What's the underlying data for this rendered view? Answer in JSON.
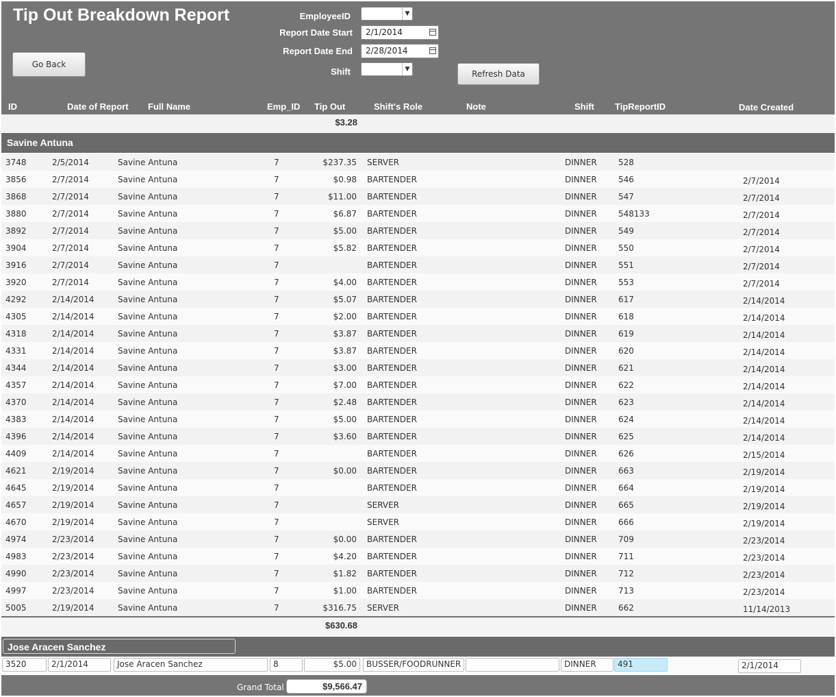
{
  "header": {
    "title": "Tip Out Breakdown Report",
    "go_back_label": "Go Back",
    "refresh_label": "Refresh Data"
  },
  "filters": {
    "employee_id": {
      "label": "EmployeeID",
      "value": ""
    },
    "report_date_start": {
      "label": "Report Date Start",
      "value": "2/1/2014"
    },
    "report_date_end": {
      "label": "Report Date End",
      "value": "2/28/2014"
    },
    "shift": {
      "label": "Shift",
      "value": ""
    }
  },
  "columns": {
    "id": "ID",
    "date_of_report": "Date of Report",
    "full_name": "Full Name",
    "emp_id": "Emp_ID",
    "tip_out": "Tip Out",
    "shifts_role": "Shift's Role",
    "note": "Note",
    "shift": "Shift",
    "tip_report_id": "TipReportID",
    "date_created": "Date Created"
  },
  "report_header_total": "$3.28",
  "groups": [
    {
      "name": "Savine Antuna",
      "total": "$630.68",
      "rows": [
        {
          "id": "3748",
          "date": "2/5/2014",
          "name": "Savine Antuna",
          "emp_id": "7",
          "tip_out": "$237.35",
          "role": "SERVER",
          "note": "",
          "shift": "DINNER",
          "tip_report_id": "528",
          "created": ""
        },
        {
          "id": "3856",
          "date": "2/7/2014",
          "name": "Savine Antuna",
          "emp_id": "7",
          "tip_out": "$0.98",
          "role": "BARTENDER",
          "note": "",
          "shift": "DINNER",
          "tip_report_id": "546",
          "created": "2/7/2014"
        },
        {
          "id": "3868",
          "date": "2/7/2014",
          "name": "Savine Antuna",
          "emp_id": "7",
          "tip_out": "$11.00",
          "role": "BARTENDER",
          "note": "",
          "shift": "DINNER",
          "tip_report_id": "547",
          "created": "2/7/2014"
        },
        {
          "id": "3880",
          "date": "2/7/2014",
          "name": "Savine Antuna",
          "emp_id": "7",
          "tip_out": "$6.87",
          "role": "BARTENDER",
          "note": "",
          "shift": "DINNER",
          "tip_report_id": "548133",
          "created": "2/7/2014"
        },
        {
          "id": "3892",
          "date": "2/7/2014",
          "name": "Savine Antuna",
          "emp_id": "7",
          "tip_out": "$5.00",
          "role": "BARTENDER",
          "note": "",
          "shift": "DINNER",
          "tip_report_id": "549",
          "created": "2/7/2014"
        },
        {
          "id": "3904",
          "date": "2/7/2014",
          "name": "Savine Antuna",
          "emp_id": "7",
          "tip_out": "$5.82",
          "role": "BARTENDER",
          "note": "",
          "shift": "DINNER",
          "tip_report_id": "550",
          "created": "2/7/2014"
        },
        {
          "id": "3916",
          "date": "2/7/2014",
          "name": "Savine Antuna",
          "emp_id": "7",
          "tip_out": "",
          "role": "BARTENDER",
          "note": "",
          "shift": "DINNER",
          "tip_report_id": "551",
          "created": "2/7/2014"
        },
        {
          "id": "3920",
          "date": "2/7/2014",
          "name": "Savine Antuna",
          "emp_id": "7",
          "tip_out": "$4.00",
          "role": "BARTENDER",
          "note": "",
          "shift": "DINNER",
          "tip_report_id": "553",
          "created": "2/7/2014"
        },
        {
          "id": "4292",
          "date": "2/14/2014",
          "name": "Savine Antuna",
          "emp_id": "7",
          "tip_out": "$5.07",
          "role": "BARTENDER",
          "note": "",
          "shift": "DINNER",
          "tip_report_id": "617",
          "created": "2/14/2014"
        },
        {
          "id": "4305",
          "date": "2/14/2014",
          "name": "Savine Antuna",
          "emp_id": "7",
          "tip_out": "$2.00",
          "role": "BARTENDER",
          "note": "",
          "shift": "DINNER",
          "tip_report_id": "618",
          "created": "2/14/2014"
        },
        {
          "id": "4318",
          "date": "2/14/2014",
          "name": "Savine Antuna",
          "emp_id": "7",
          "tip_out": "$3.87",
          "role": "BARTENDER",
          "note": "",
          "shift": "DINNER",
          "tip_report_id": "619",
          "created": "2/14/2014"
        },
        {
          "id": "4331",
          "date": "2/14/2014",
          "name": "Savine Antuna",
          "emp_id": "7",
          "tip_out": "$3.87",
          "role": "BARTENDER",
          "note": "",
          "shift": "DINNER",
          "tip_report_id": "620",
          "created": "2/14/2014"
        },
        {
          "id": "4344",
          "date": "2/14/2014",
          "name": "Savine Antuna",
          "emp_id": "7",
          "tip_out": "$3.00",
          "role": "BARTENDER",
          "note": "",
          "shift": "DINNER",
          "tip_report_id": "621",
          "created": "2/14/2014"
        },
        {
          "id": "4357",
          "date": "2/14/2014",
          "name": "Savine Antuna",
          "emp_id": "7",
          "tip_out": "$7.00",
          "role": "BARTENDER",
          "note": "",
          "shift": "DINNER",
          "tip_report_id": "622",
          "created": "2/14/2014"
        },
        {
          "id": "4370",
          "date": "2/14/2014",
          "name": "Savine Antuna",
          "emp_id": "7",
          "tip_out": "$2.48",
          "role": "BARTENDER",
          "note": "",
          "shift": "DINNER",
          "tip_report_id": "623",
          "created": "2/14/2014"
        },
        {
          "id": "4383",
          "date": "2/14/2014",
          "name": "Savine Antuna",
          "emp_id": "7",
          "tip_out": "$5.00",
          "role": "BARTENDER",
          "note": "",
          "shift": "DINNER",
          "tip_report_id": "624",
          "created": "2/14/2014"
        },
        {
          "id": "4396",
          "date": "2/14/2014",
          "name": "Savine Antuna",
          "emp_id": "7",
          "tip_out": "$3.60",
          "role": "BARTENDER",
          "note": "",
          "shift": "DINNER",
          "tip_report_id": "625",
          "created": "2/14/2014"
        },
        {
          "id": "4409",
          "date": "2/14/2014",
          "name": "Savine Antuna",
          "emp_id": "7",
          "tip_out": "",
          "role": "BARTENDER",
          "note": "",
          "shift": "DINNER",
          "tip_report_id": "626",
          "created": "2/15/2014"
        },
        {
          "id": "4621",
          "date": "2/19/2014",
          "name": "Savine Antuna",
          "emp_id": "7",
          "tip_out": "$0.00",
          "role": "BARTENDER",
          "note": "",
          "shift": "DINNER",
          "tip_report_id": "663",
          "created": "2/19/2014"
        },
        {
          "id": "4645",
          "date": "2/19/2014",
          "name": "Savine Antuna",
          "emp_id": "7",
          "tip_out": "",
          "role": "BARTENDER",
          "note": "",
          "shift": "DINNER",
          "tip_report_id": "664",
          "created": "2/19/2014"
        },
        {
          "id": "4657",
          "date": "2/19/2014",
          "name": "Savine Antuna",
          "emp_id": "7",
          "tip_out": "",
          "role": "SERVER",
          "note": "",
          "shift": "DINNER",
          "tip_report_id": "665",
          "created": "2/19/2014"
        },
        {
          "id": "4670",
          "date": "2/19/2014",
          "name": "Savine Antuna",
          "emp_id": "7",
          "tip_out": "",
          "role": "SERVER",
          "note": "",
          "shift": "DINNER",
          "tip_report_id": "666",
          "created": "2/19/2014"
        },
        {
          "id": "4974",
          "date": "2/23/2014",
          "name": "Savine Antuna",
          "emp_id": "7",
          "tip_out": "$0.00",
          "role": "BARTENDER",
          "note": "",
          "shift": "DINNER",
          "tip_report_id": "709",
          "created": "2/23/2014"
        },
        {
          "id": "4983",
          "date": "2/23/2014",
          "name": "Savine Antuna",
          "emp_id": "7",
          "tip_out": "$4.20",
          "role": "BARTENDER",
          "note": "",
          "shift": "DINNER",
          "tip_report_id": "711",
          "created": "2/23/2014"
        },
        {
          "id": "4990",
          "date": "2/23/2014",
          "name": "Savine Antuna",
          "emp_id": "7",
          "tip_out": "$1.82",
          "role": "BARTENDER",
          "note": "",
          "shift": "DINNER",
          "tip_report_id": "712",
          "created": "2/23/2014"
        },
        {
          "id": "4997",
          "date": "2/23/2014",
          "name": "Savine Antuna",
          "emp_id": "7",
          "tip_out": "$1.00",
          "role": "BARTENDER",
          "note": "",
          "shift": "DINNER",
          "tip_report_id": "713",
          "created": "2/23/2014"
        },
        {
          "id": "5005",
          "date": "2/19/2014",
          "name": "Savine Antuna",
          "emp_id": "7",
          "tip_out": "$316.75",
          "role": "SERVER",
          "note": "",
          "shift": "DINNER",
          "tip_report_id": "662",
          "created": "11/14/2013"
        }
      ]
    },
    {
      "name": "Jose Aracen Sanchez",
      "rows": [
        {
          "id": "3520",
          "date": "2/1/2014",
          "name": "Jose Aracen Sanchez",
          "emp_id": "8",
          "tip_out": "$5.00",
          "role": "BUSSER/FOODRUNNER",
          "note": "",
          "shift": "DINNER",
          "tip_report_id": "491",
          "created": "2/1/2014"
        }
      ]
    }
  ],
  "grand_total": {
    "label": "Grand Total",
    "value": "$9,566.47"
  }
}
